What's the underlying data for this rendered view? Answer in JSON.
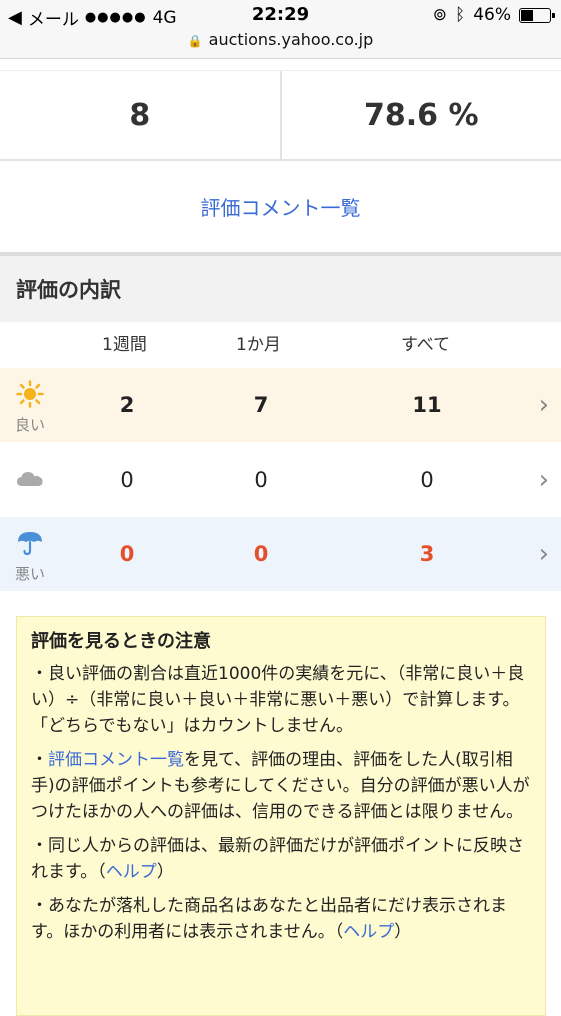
{
  "status_bar": {
    "back_label": "メール",
    "signal": "●●●●●",
    "network": "4G",
    "time": "22:29",
    "battery": "46%",
    "battery_level": 0.46
  },
  "url_bar": {
    "url": "auctions.yahoo.co.jp"
  },
  "stats": {
    "count": "8",
    "percent": "78.6 %"
  },
  "comments_link": "評価コメント一覧",
  "breakdown": {
    "title": "評価の内訳",
    "columns": [
      "1週間",
      "1か月",
      "すべて"
    ],
    "rows": [
      {
        "label": "良い",
        "icon": "sun-icon",
        "values": [
          "2",
          "7",
          "11"
        ]
      },
      {
        "label": "",
        "icon": "cloud-icon",
        "values": [
          "0",
          "0",
          "0"
        ]
      },
      {
        "label": "悪い",
        "icon": "umbrella-icon",
        "values": [
          "0",
          "0",
          "3"
        ]
      }
    ]
  },
  "notes": {
    "title": "評価を見るときの注意",
    "p1": "・良い評価の割合は直近1000件の実績を元に、（非常に良い＋良い）÷（非常に良い＋良い＋非常に悪い＋悪い）で計算します。「どちらでもない」はカウントしません。",
    "p2_prefix": "・",
    "p2_link": "評価コメント一覧",
    "p2_rest": "を見て、評価の理由、評価をした人(取引相手)の評価ポイントも参考にしてください。自分の評価が悪い人がつけたほかの人への評価は、信用のできる評価とは限りません。",
    "p3_text": "・同じ人からの評価は、最新の評価だけが評価ポイントに反映されます。（",
    "p3_link": "ヘルプ",
    "p3_end": "）",
    "p4_text": "・あなたが落札した商品名はあなたと出品者にだけ表示されます。ほかの利用者には表示されません。（",
    "p4_link": "ヘルプ",
    "p4_end": "）"
  }
}
